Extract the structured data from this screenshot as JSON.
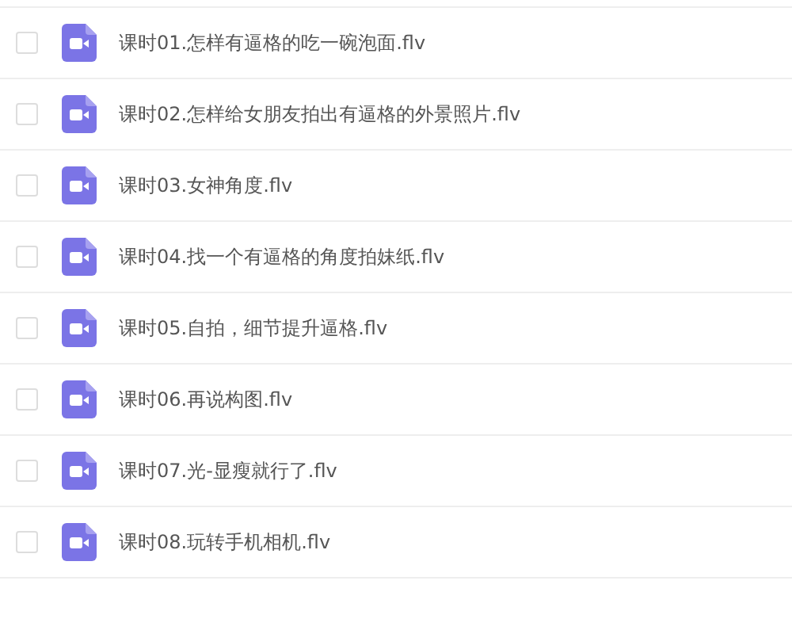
{
  "files": [
    {
      "name": "课时01.怎样有逼格的吃一碗泡面.flv",
      "checked": false
    },
    {
      "name": "课时02.怎样给女朋友拍出有逼格的外景照片.flv",
      "checked": false
    },
    {
      "name": "课时03.女神角度.flv",
      "checked": false
    },
    {
      "name": "课时04.找一个有逼格的角度拍妹纸.flv",
      "checked": false
    },
    {
      "name": "课时05.自拍，细节提升逼格.flv",
      "checked": false
    },
    {
      "name": "课时06.再说构图.flv",
      "checked": false
    },
    {
      "name": "课时07.光-显瘦就行了.flv",
      "checked": false
    },
    {
      "name": "课时08.玩转手机相机.flv",
      "checked": false
    }
  ]
}
